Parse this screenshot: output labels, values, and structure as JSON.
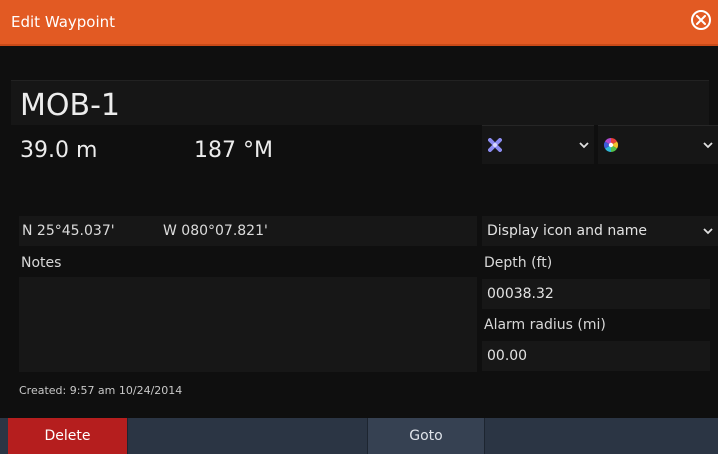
{
  "window": {
    "title": "Edit Waypoint",
    "close_icon": "close-circle-icon"
  },
  "waypoint": {
    "name": "MOB-1",
    "range": "39.0 m",
    "bearing": "187 °M",
    "latitude": "N 25°45.037'",
    "longitude": "W 080°07.821'",
    "symbol_icon": "x-marker-icon",
    "color_icon": "color-wheel-icon",
    "display_mode": "Display icon and name",
    "notes_label": "Notes",
    "notes": "",
    "depth_label": "Depth (ft)",
    "depth_value": "00038.32",
    "alarm_label": "Alarm radius (mi)",
    "alarm_value": "00.00",
    "created": "Created: 9:57 am  10/24/2014"
  },
  "buttons": {
    "delete": "Delete",
    "goto": "Goto"
  },
  "colors": {
    "accent": "#e25a23",
    "delete": "#b51e1e",
    "toolbar": "#2b3544",
    "background": "#0f0f0f"
  }
}
